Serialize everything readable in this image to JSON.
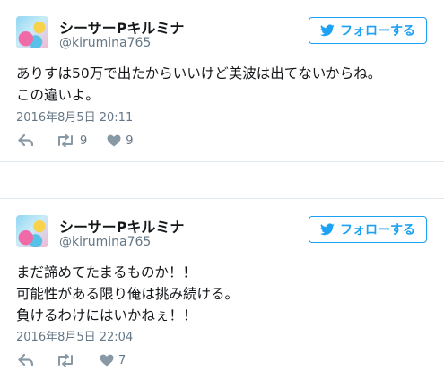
{
  "tweets": [
    {
      "display_name": "シーサーPキルミナ",
      "handle": "@kirumina765",
      "follow_label": "フォローする",
      "text_lines": [
        "ありすは50万で出たからいいけど美波は出てないからね。",
        "この違いよ。"
      ],
      "timestamp": "2016年8月5日 20:11",
      "retweets": "9",
      "likes": "9"
    },
    {
      "display_name": "シーサーPキルミナ",
      "handle": "@kirumina765",
      "follow_label": "フォローする",
      "text_lines": [
        "まだ諦めてたまるものか！！",
        "可能性がある限り俺は挑み続ける。",
        "負けるわけにはいかねぇ！！"
      ],
      "timestamp": "2016年8月5日 22:04",
      "retweets": "",
      "likes": "7"
    }
  ],
  "colors": {
    "twitter_blue": "#1da1f2",
    "muted": "#657786",
    "icon": "#8899a6",
    "divider": "#e1e8ed"
  },
  "icons": [
    "twitter-bird-icon",
    "reply-icon",
    "retweet-icon",
    "heart-icon"
  ]
}
